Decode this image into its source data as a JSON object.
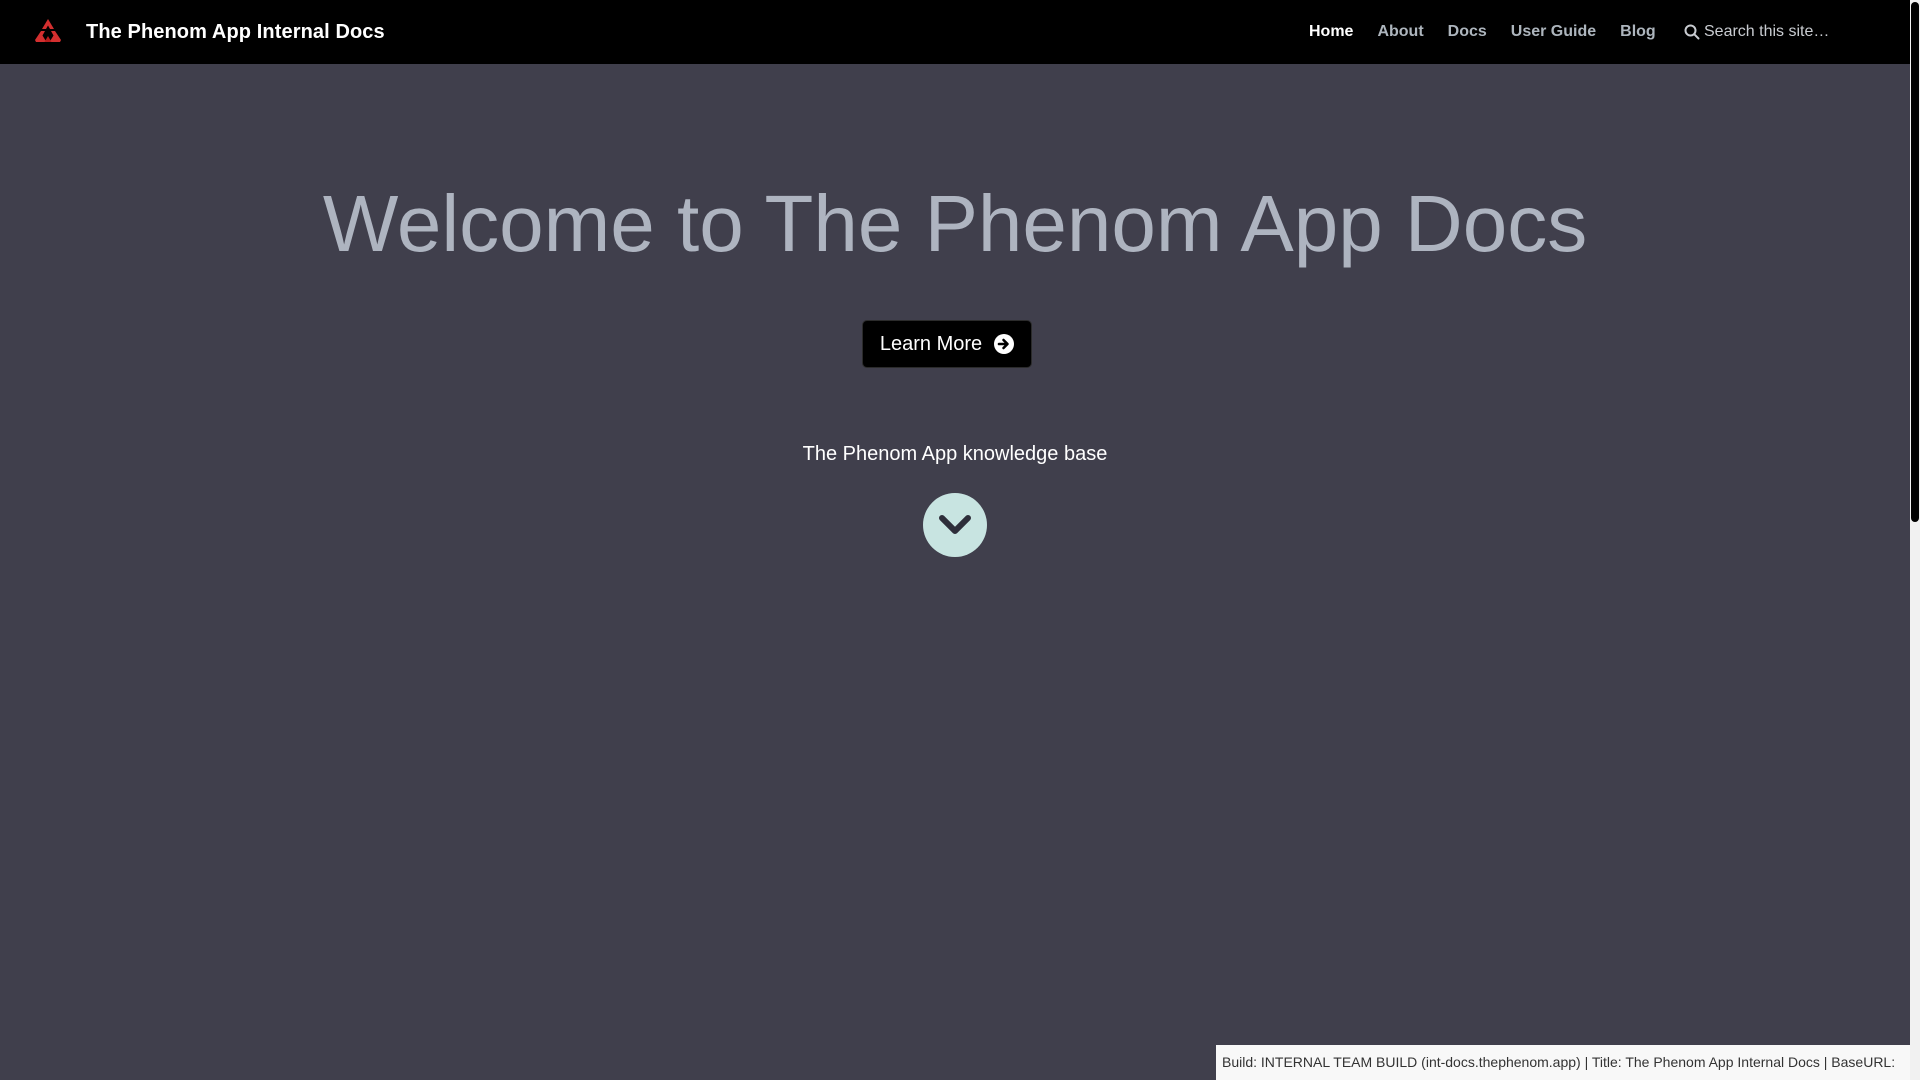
{
  "navbar": {
    "brand_title": "The Phenom App Internal Docs",
    "logo_icon": "phenom-logo-icon",
    "logo_color": "#d32f2f",
    "links": [
      {
        "label": "Home",
        "active": true
      },
      {
        "label": "About",
        "active": false
      },
      {
        "label": "Docs",
        "active": false
      },
      {
        "label": "User Guide",
        "active": false
      },
      {
        "label": "Blog",
        "active": false
      }
    ],
    "search": {
      "placeholder": "Search this site…",
      "icon": "search-icon"
    }
  },
  "hero": {
    "title": "Welcome to The Phenom App Docs",
    "learn_more_label": "Learn More",
    "learn_more_icon": "arrow-circle-right-icon",
    "tagline": "The Phenom App knowledge base",
    "scroll_down_icon": "chevron-down-icon"
  },
  "footer": {
    "build_text": "Build: INTERNAL TEAM BUILD (int-docs.thephenom.app) | Title: The Phenom App Internal Docs | BaseURL:"
  },
  "colors": {
    "page_background": "#403f4c",
    "navbar_background": "#000000",
    "hero_title": "#aeb4c0",
    "scroll_button": "#c8e4e1"
  }
}
